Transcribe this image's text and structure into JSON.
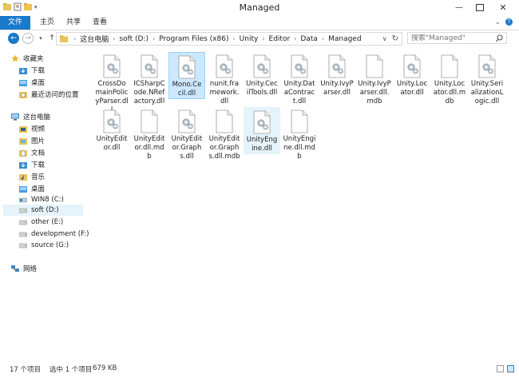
{
  "window": {
    "title": "Managed",
    "controls": [
      "minimize-icon",
      "maximize-icon",
      "close-icon"
    ]
  },
  "ribbon": {
    "tabs": [
      "文件",
      "主页",
      "共享",
      "查看"
    ]
  },
  "address": {
    "segments": [
      "这台电脑",
      "soft (D:)",
      "Program Files (x86)",
      "Unity",
      "Editor",
      "Data",
      "Managed"
    ]
  },
  "search": {
    "placeholder": "搜索\"Managed\""
  },
  "sidebar": {
    "items": [
      {
        "label": "收藏夹",
        "icon": "star-icon"
      },
      {
        "label": "下载",
        "icon": "download-folder-icon"
      },
      {
        "label": "桌面",
        "icon": "desktop-folder-icon"
      },
      {
        "label": "最近访问的位置",
        "icon": "recent-places-icon"
      },
      {
        "label": "这台电脑",
        "icon": "computer-icon"
      },
      {
        "label": "视频",
        "icon": "video-folder-icon"
      },
      {
        "label": "图片",
        "icon": "pictures-folder-icon"
      },
      {
        "label": "文档",
        "icon": "documents-folder-icon"
      },
      {
        "label": "下载",
        "icon": "download-folder-icon"
      },
      {
        "label": "音乐",
        "icon": "music-folder-icon"
      },
      {
        "label": "桌面",
        "icon": "desktop-folder-icon"
      },
      {
        "label": "WIN8 (C:)",
        "icon": "windows-drive-icon"
      },
      {
        "label": "soft (D:)",
        "icon": "drive-icon"
      },
      {
        "label": "other (E:)",
        "icon": "drive-icon"
      },
      {
        "label": "development (F:)",
        "icon": "drive-icon"
      },
      {
        "label": "source (G:)",
        "icon": "drive-icon"
      },
      {
        "label": "网络",
        "icon": "network-icon"
      }
    ]
  },
  "files": [
    {
      "name": "CrossDomainPolicyParser.dll",
      "type": "dll"
    },
    {
      "name": "ICSharpCode.NRefactory.dll",
      "type": "dll"
    },
    {
      "name": "Mono.Cecil.dll",
      "type": "dll"
    },
    {
      "name": "nunit.framework.dll",
      "type": "dll"
    },
    {
      "name": "Unity.CecilTools.dll",
      "type": "dll"
    },
    {
      "name": "Unity.DataContract.dll",
      "type": "dll"
    },
    {
      "name": "Unity.IvyParser.dll",
      "type": "dll"
    },
    {
      "name": "Unity.IvyParser.dll.mdb",
      "type": "mdb"
    },
    {
      "name": "Unity.Locator.dll",
      "type": "dll"
    },
    {
      "name": "Unity.Locator.dll.mdb",
      "type": "mdb"
    },
    {
      "name": "Unity.SerializationLogic.dll",
      "type": "dll"
    },
    {
      "name": "UnityEditor.dll",
      "type": "dll"
    },
    {
      "name": "UnityEditor.dll.mdb",
      "type": "mdb"
    },
    {
      "name": "UnityEditor.Graphs.dll",
      "type": "dll"
    },
    {
      "name": "UnityEditor.Graphs.dll.mdb",
      "type": "mdb"
    },
    {
      "name": "UnityEngine.dll",
      "type": "dll"
    },
    {
      "name": "UnityEngine.dll.mdb",
      "type": "mdb"
    }
  ],
  "status": {
    "count": "17 个项目",
    "selection": "选中 1 个项目",
    "size": "679 KB"
  }
}
